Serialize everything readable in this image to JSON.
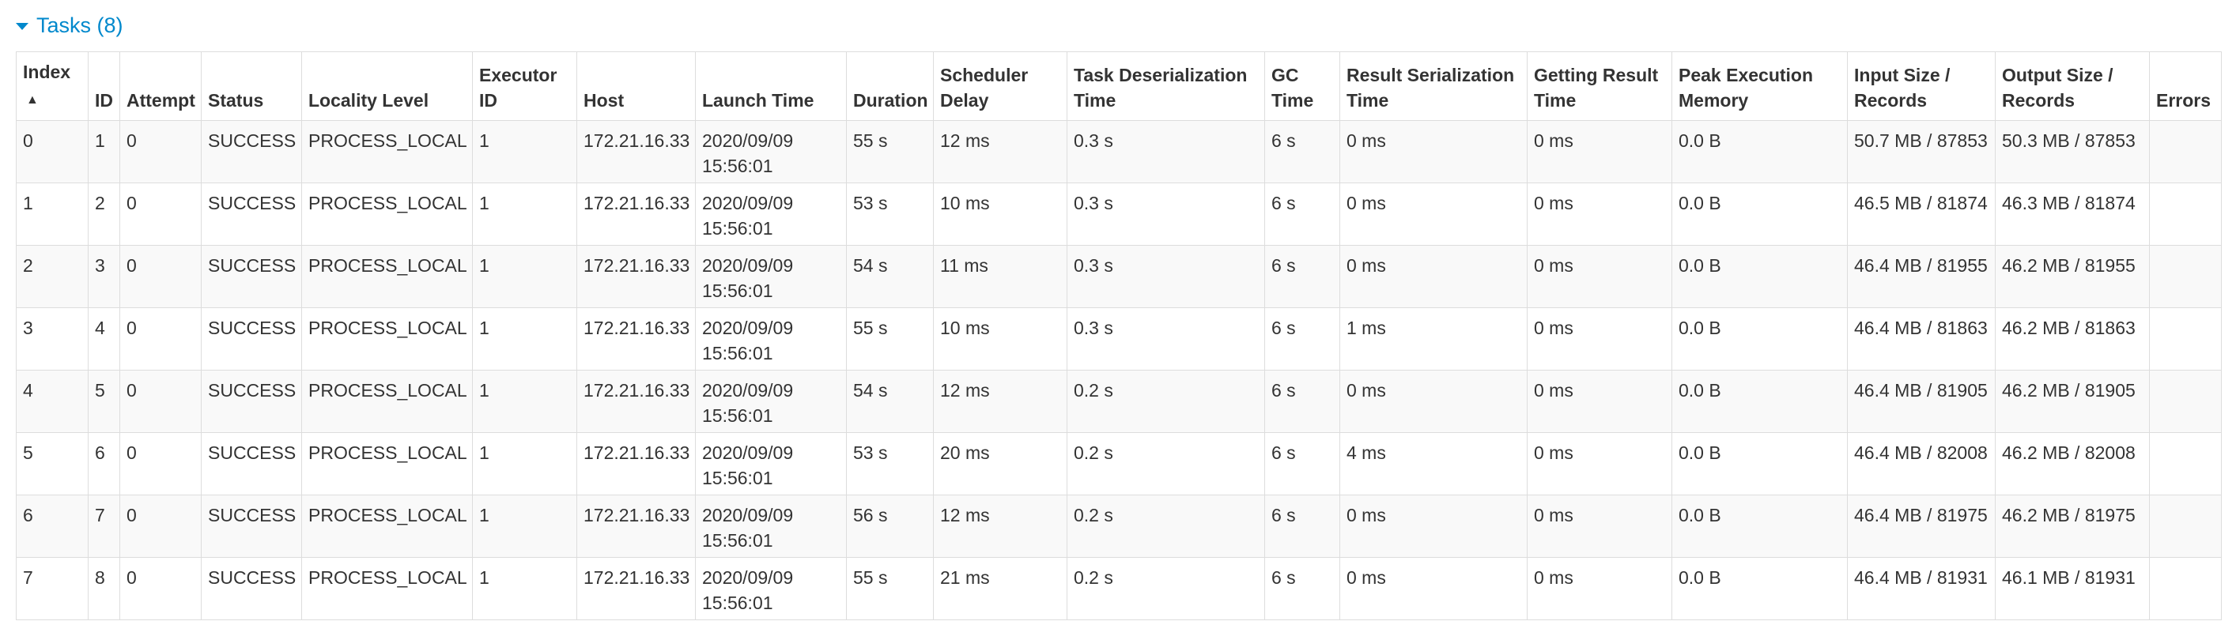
{
  "section": {
    "title": "Tasks (8)"
  },
  "table": {
    "headers": [
      {
        "line1": "Index",
        "line2": "",
        "sort": "▲"
      },
      {
        "line1": "",
        "line2": "ID",
        "sort": ""
      },
      {
        "line1": "",
        "line2": "Attempt",
        "sort": ""
      },
      {
        "line1": "",
        "line2": "Status",
        "sort": ""
      },
      {
        "line1": "",
        "line2": "Locality Level",
        "sort": ""
      },
      {
        "line1": "Executor",
        "line2": "ID",
        "sort": ""
      },
      {
        "line1": "",
        "line2": "Host",
        "sort": ""
      },
      {
        "line1": "",
        "line2": "Launch Time",
        "sort": ""
      },
      {
        "line1": "",
        "line2": "Duration",
        "sort": ""
      },
      {
        "line1": "Scheduler",
        "line2": "Delay",
        "sort": ""
      },
      {
        "line1": "Task Deserialization",
        "line2": "Time",
        "sort": ""
      },
      {
        "line1": "GC",
        "line2": "Time",
        "sort": ""
      },
      {
        "line1": "Result Serialization",
        "line2": "Time",
        "sort": ""
      },
      {
        "line1": "Getting Result",
        "line2": "Time",
        "sort": ""
      },
      {
        "line1": "Peak Execution",
        "line2": "Memory",
        "sort": ""
      },
      {
        "line1": "Input Size /",
        "line2": "Records",
        "sort": ""
      },
      {
        "line1": "Output Size /",
        "line2": "Records",
        "sort": ""
      },
      {
        "line1": "",
        "line2": "Errors",
        "sort": ""
      }
    ],
    "rows": [
      {
        "index": "0",
        "id": "1",
        "attempt": "0",
        "status": "SUCCESS",
        "locality": "PROCESS_LOCAL",
        "executor": "1",
        "host": "172.21.16.33",
        "launch_date": "2020/09/09",
        "launch_time": "15:56:01",
        "duration": "55 s",
        "scheduler_delay": "12 ms",
        "task_deser": "0.3 s",
        "gc_time": "6 s",
        "result_ser": "0 ms",
        "getting_result": "0 ms",
        "peak_mem": "0.0 B",
        "input": "50.7 MB / 87853",
        "output": "50.3 MB / 87853",
        "errors": ""
      },
      {
        "index": "1",
        "id": "2",
        "attempt": "0",
        "status": "SUCCESS",
        "locality": "PROCESS_LOCAL",
        "executor": "1",
        "host": "172.21.16.33",
        "launch_date": "2020/09/09",
        "launch_time": "15:56:01",
        "duration": "53 s",
        "scheduler_delay": "10 ms",
        "task_deser": "0.3 s",
        "gc_time": "6 s",
        "result_ser": "0 ms",
        "getting_result": "0 ms",
        "peak_mem": "0.0 B",
        "input": "46.5 MB / 81874",
        "output": "46.3 MB / 81874",
        "errors": ""
      },
      {
        "index": "2",
        "id": "3",
        "attempt": "0",
        "status": "SUCCESS",
        "locality": "PROCESS_LOCAL",
        "executor": "1",
        "host": "172.21.16.33",
        "launch_date": "2020/09/09",
        "launch_time": "15:56:01",
        "duration": "54 s",
        "scheduler_delay": "11 ms",
        "task_deser": "0.3 s",
        "gc_time": "6 s",
        "result_ser": "0 ms",
        "getting_result": "0 ms",
        "peak_mem": "0.0 B",
        "input": "46.4 MB / 81955",
        "output": "46.2 MB / 81955",
        "errors": ""
      },
      {
        "index": "3",
        "id": "4",
        "attempt": "0",
        "status": "SUCCESS",
        "locality": "PROCESS_LOCAL",
        "executor": "1",
        "host": "172.21.16.33",
        "launch_date": "2020/09/09",
        "launch_time": "15:56:01",
        "duration": "55 s",
        "scheduler_delay": "10 ms",
        "task_deser": "0.3 s",
        "gc_time": "6 s",
        "result_ser": "1 ms",
        "getting_result": "0 ms",
        "peak_mem": "0.0 B",
        "input": "46.4 MB / 81863",
        "output": "46.2 MB / 81863",
        "errors": ""
      },
      {
        "index": "4",
        "id": "5",
        "attempt": "0",
        "status": "SUCCESS",
        "locality": "PROCESS_LOCAL",
        "executor": "1",
        "host": "172.21.16.33",
        "launch_date": "2020/09/09",
        "launch_time": "15:56:01",
        "duration": "54 s",
        "scheduler_delay": "12 ms",
        "task_deser": "0.2 s",
        "gc_time": "6 s",
        "result_ser": "0 ms",
        "getting_result": "0 ms",
        "peak_mem": "0.0 B",
        "input": "46.4 MB / 81905",
        "output": "46.2 MB / 81905",
        "errors": ""
      },
      {
        "index": "5",
        "id": "6",
        "attempt": "0",
        "status": "SUCCESS",
        "locality": "PROCESS_LOCAL",
        "executor": "1",
        "host": "172.21.16.33",
        "launch_date": "2020/09/09",
        "launch_time": "15:56:01",
        "duration": "53 s",
        "scheduler_delay": "20 ms",
        "task_deser": "0.2 s",
        "gc_time": "6 s",
        "result_ser": "4 ms",
        "getting_result": "0 ms",
        "peak_mem": "0.0 B",
        "input": "46.4 MB / 82008",
        "output": "46.2 MB / 82008",
        "errors": ""
      },
      {
        "index": "6",
        "id": "7",
        "attempt": "0",
        "status": "SUCCESS",
        "locality": "PROCESS_LOCAL",
        "executor": "1",
        "host": "172.21.16.33",
        "launch_date": "2020/09/09",
        "launch_time": "15:56:01",
        "duration": "56 s",
        "scheduler_delay": "12 ms",
        "task_deser": "0.2 s",
        "gc_time": "6 s",
        "result_ser": "0 ms",
        "getting_result": "0 ms",
        "peak_mem": "0.0 B",
        "input": "46.4 MB / 81975",
        "output": "46.2 MB / 81975",
        "errors": ""
      },
      {
        "index": "7",
        "id": "8",
        "attempt": "0",
        "status": "SUCCESS",
        "locality": "PROCESS_LOCAL",
        "executor": "1",
        "host": "172.21.16.33",
        "launch_date": "2020/09/09",
        "launch_time": "15:56:01",
        "duration": "55 s",
        "scheduler_delay": "21 ms",
        "task_deser": "0.2 s",
        "gc_time": "6 s",
        "result_ser": "0 ms",
        "getting_result": "0 ms",
        "peak_mem": "0.0 B",
        "input": "46.4 MB / 81931",
        "output": "46.1 MB / 81931",
        "errors": ""
      }
    ]
  },
  "colors": {
    "accent": "#0088cc",
    "text": "#333333",
    "border": "#dddddd",
    "stripe": "#f9f9f9"
  }
}
